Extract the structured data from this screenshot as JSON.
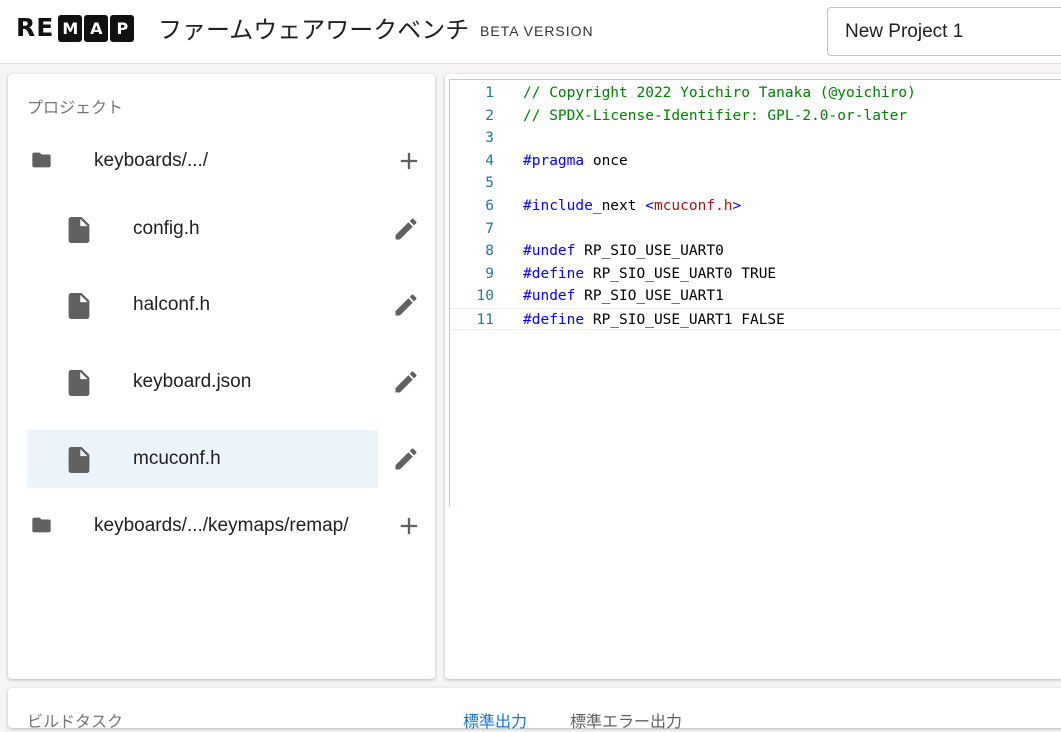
{
  "header": {
    "logo_letters": [
      "RE",
      "M",
      "A",
      "P"
    ],
    "title": "ファームウェアワークベンチ",
    "badge": "BETA VERSION",
    "project_name": "New Project 1"
  },
  "sidebar": {
    "title": "プロジェクト",
    "folders": [
      {
        "label": "keyboards/.../",
        "icon": "folder-icon",
        "action_icon": "add-icon"
      },
      {
        "label": "keyboards/.../keymaps/remap/",
        "icon": "folder-icon",
        "action_icon": "add-icon"
      }
    ],
    "files": [
      {
        "label": "config.h",
        "icon": "file-icon",
        "action_icon": "edit-icon",
        "selected": false
      },
      {
        "label": "halconf.h",
        "icon": "file-icon",
        "action_icon": "edit-icon",
        "selected": false
      },
      {
        "label": "keyboard.json",
        "icon": "file-icon",
        "action_icon": "edit-icon",
        "selected": false
      },
      {
        "label": "mcuconf.h",
        "icon": "file-icon",
        "action_icon": "edit-icon",
        "selected": true
      }
    ]
  },
  "editor": {
    "lines": [
      {
        "n": "1",
        "parts": [
          {
            "t": "// Copyright 2022 Yoichiro Tanaka (@yoichiro)",
            "k": "comment"
          }
        ]
      },
      {
        "n": "2",
        "parts": [
          {
            "t": "// SPDX-License-Identifier: GPL-2.0-or-later",
            "k": "comment"
          }
        ]
      },
      {
        "n": "3",
        "parts": []
      },
      {
        "n": "4",
        "parts": [
          {
            "t": "#pragma",
            "k": "directive"
          },
          {
            "t": " once",
            "k": "plain"
          }
        ]
      },
      {
        "n": "5",
        "parts": []
      },
      {
        "n": "6",
        "parts": [
          {
            "t": "#include",
            "k": "directive"
          },
          {
            "t": "_next ",
            "k": "plain"
          },
          {
            "t": "<",
            "k": "directive"
          },
          {
            "t": "mcuconf.h",
            "k": "string"
          },
          {
            "t": ">",
            "k": "directive"
          }
        ]
      },
      {
        "n": "7",
        "parts": []
      },
      {
        "n": "8",
        "parts": [
          {
            "t": "#undef",
            "k": "directive"
          },
          {
            "t": " RP_SIO_USE_UART0",
            "k": "plain"
          }
        ]
      },
      {
        "n": "9",
        "parts": [
          {
            "t": "#define",
            "k": "directive"
          },
          {
            "t": " RP_SIO_USE_UART0 TRUE",
            "k": "plain"
          }
        ]
      },
      {
        "n": "10",
        "parts": [
          {
            "t": "#undef",
            "k": "directive"
          },
          {
            "t": " RP_SIO_USE_UART1",
            "k": "plain"
          }
        ]
      },
      {
        "n": "11",
        "parts": [
          {
            "t": "#define",
            "k": "directive"
          },
          {
            "t": " RP_SIO_USE_UART1 FALSE",
            "k": "plain"
          }
        ]
      }
    ]
  },
  "bottom": {
    "title": "ビルドタスク",
    "tabs": [
      {
        "label": "標準出力",
        "active": true
      },
      {
        "label": "標準エラー出力",
        "active": false
      }
    ]
  },
  "colors": {
    "accent": "#1976d2",
    "selected_bg": "#ebf3fb",
    "icon_gray": "#616161"
  }
}
